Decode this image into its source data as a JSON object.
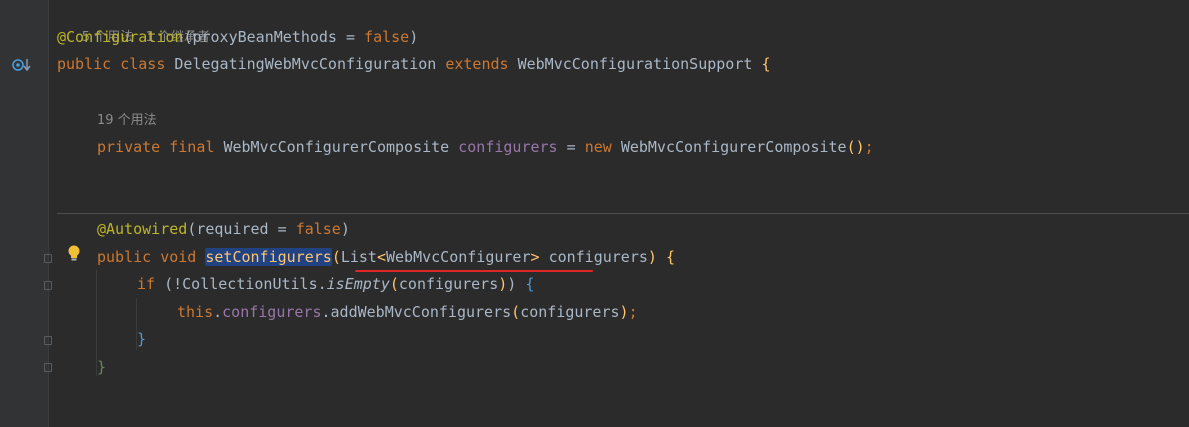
{
  "hints": {
    "class_usages": "5 个用法",
    "class_inheritors": "1 个继承者",
    "field_usages": "19 个用法"
  },
  "code": {
    "configuration_annotation": "@Configuration",
    "configuration_paren_open": "(",
    "proxy_param": "proxyBeanMethods = ",
    "false_value": "false",
    "paren_close": ")",
    "public_kw": "public",
    "class_kw": "class",
    "class_name": "DelegatingWebMvcConfiguration",
    "extends_kw": "extends",
    "super_class": "WebMvcConfigurationSupport",
    "brace_open": "{",
    "private_kw": "private",
    "final_kw": "final",
    "field_type": "WebMvcConfigurerComposite",
    "field_name": "configurers",
    "assign": " = ",
    "new_kw": "new",
    "ctor_call": "WebMvcConfigurerComposite",
    "ctor_parens": "()",
    "semicolon": ";",
    "autowired_annotation": "@Autowired",
    "required_param": "required = ",
    "void_kw": "void",
    "method_name": "setConfigurers",
    "list_type": "List",
    "generic_open": "<",
    "generic_type": "WebMvcConfigurer",
    "generic_close": ">",
    "param_name": "configurers",
    "if_kw": "if",
    "negation": "(!",
    "utils_class": "CollectionUtils.",
    "is_empty_method": "isEmpty",
    "this_kw": "this",
    "dot": ".",
    "add_method": "addWebMvcConfigurers",
    "brace_close": "}"
  },
  "colors": {
    "background": "#2b2b2b",
    "keyword": "#cc7832",
    "annotation": "#bbb529",
    "field": "#9876aa",
    "method_decl": "#ffc66d",
    "text": "#a9b7c6",
    "selection": "#214283",
    "error_underline": "#e02626"
  },
  "icons": {
    "gutter_class": "override-down-arrow-icon",
    "gutter_intention": "lightbulb-icon"
  }
}
